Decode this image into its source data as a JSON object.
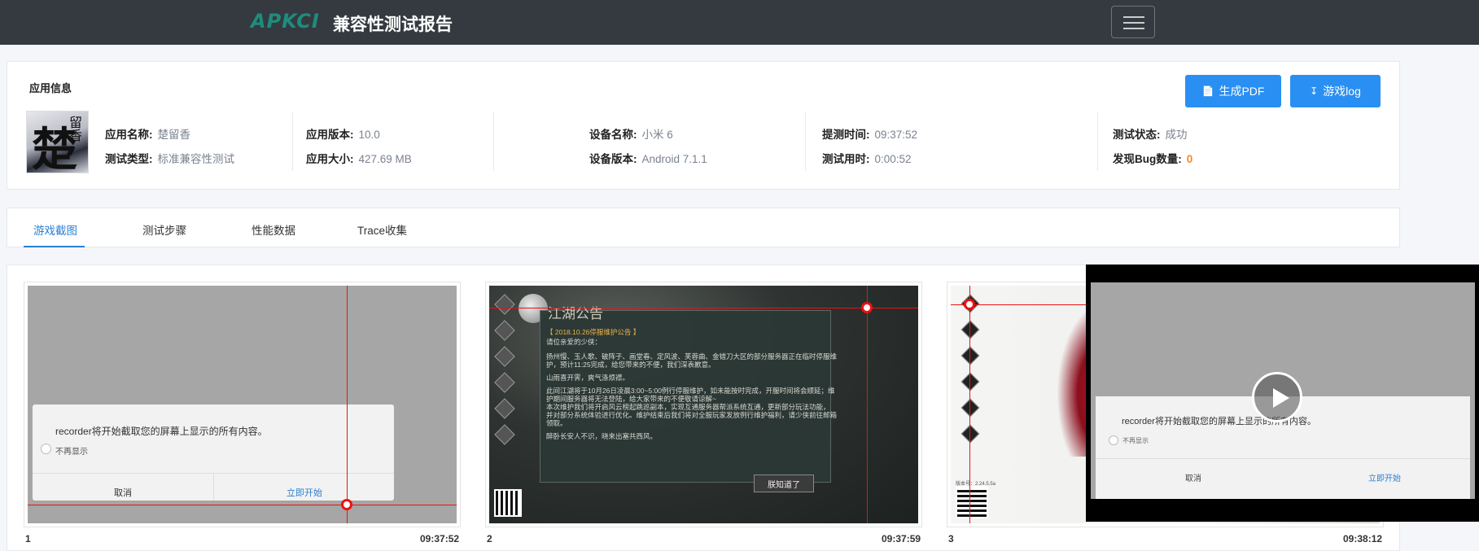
{
  "header": {
    "logo_text": "APKCI",
    "title": "兼容性测试报告",
    "menu_icon": "hamburger-icon"
  },
  "app_info": {
    "heading": "应用信息",
    "buttons": {
      "pdf": "生成PDF",
      "log": "游戏log"
    },
    "fields": {
      "app_name": {
        "label": "应用名称:",
        "value": "楚留香"
      },
      "test_type": {
        "label": "测试类型:",
        "value": "标准兼容性测试"
      },
      "app_version": {
        "label": "应用版本:",
        "value": "10.0"
      },
      "app_size": {
        "label": "应用大小:",
        "value": "427.69 MB"
      },
      "device_name": {
        "label": "设备名称:",
        "value": "小米 6"
      },
      "device_version": {
        "label": "设备版本:",
        "value": "Android 7.1.1"
      },
      "submit_time": {
        "label": "提测时间:",
        "value": "09:37:52"
      },
      "test_duration": {
        "label": "测试用时:",
        "value": "0:00:52"
      },
      "test_status": {
        "label": "测试状态:",
        "value": "成功"
      },
      "bug_count": {
        "label": "发现Bug数量:",
        "value": "0"
      }
    },
    "icon_glyph": "楚",
    "icon_glyph_small": "留香"
  },
  "tabs": [
    {
      "label": "游戏截图",
      "active": true
    },
    {
      "label": "测试步骤",
      "active": false
    },
    {
      "label": "性能数据",
      "active": false
    },
    {
      "label": "Trace收集",
      "active": false
    }
  ],
  "screenshots": [
    {
      "index": "1",
      "time": "09:37:52",
      "dialog_text": "recorder将开始截取您的屏幕上显示的所有内容。",
      "checkbox": "不再显示",
      "cancel": "取消",
      "confirm": "立即开始"
    },
    {
      "index": "2",
      "time": "09:37:59",
      "title": "江湖公告",
      "lines": [
        "【 2018.10.26停服维护公告 】",
        "请位亲爱的少侠：",
        "扬州慢、玉人歌、破阵子、画堂春、定风波、芙蓉曲、金错刀大区的部分服务器正在临时停服维",
        "护，预计11:25完成，给您带来的不便，我们深表歉意。",
        "山雨喜开霁，爽气涤烦襟。",
        "此间江湖将于10月26日凌晨3:00~5:00例行停服维护，如未能按时完成，开服时间将会顺延；维",
        "护期间服务器将无法登陆，给大家带来的不便敬请谅解~",
        "本次维护我们将开启风云榜起跳巡副本，实现互通服务器帮派系统互通，更新部分玩法功能，",
        "并对部分系统体验进行优化。维护结束后我们将对全服玩家发放例行维护福利，请少侠前往邮箱",
        "领取。",
        "醉卧长安人不识，晓来出塞共西风。"
      ],
      "ok_button": "朕知道了"
    },
    {
      "index": "3",
      "time": "09:38:12",
      "version": "版本号：2.24.5.5a"
    }
  ],
  "video": {
    "dialog_text": "recorder将开始截取您的屏幕上显示的所有内容。",
    "checkbox": "不再显示",
    "cancel": "取消",
    "confirm": "立即开始",
    "play_icon": "play-icon"
  },
  "colors": {
    "accent": "#2a8ff2",
    "navbar": "#343a40",
    "logo": "#1f8c7c",
    "status_ok": "#7a8290",
    "bug_count": "#f28b2b",
    "tap_marker": "#e11111"
  }
}
